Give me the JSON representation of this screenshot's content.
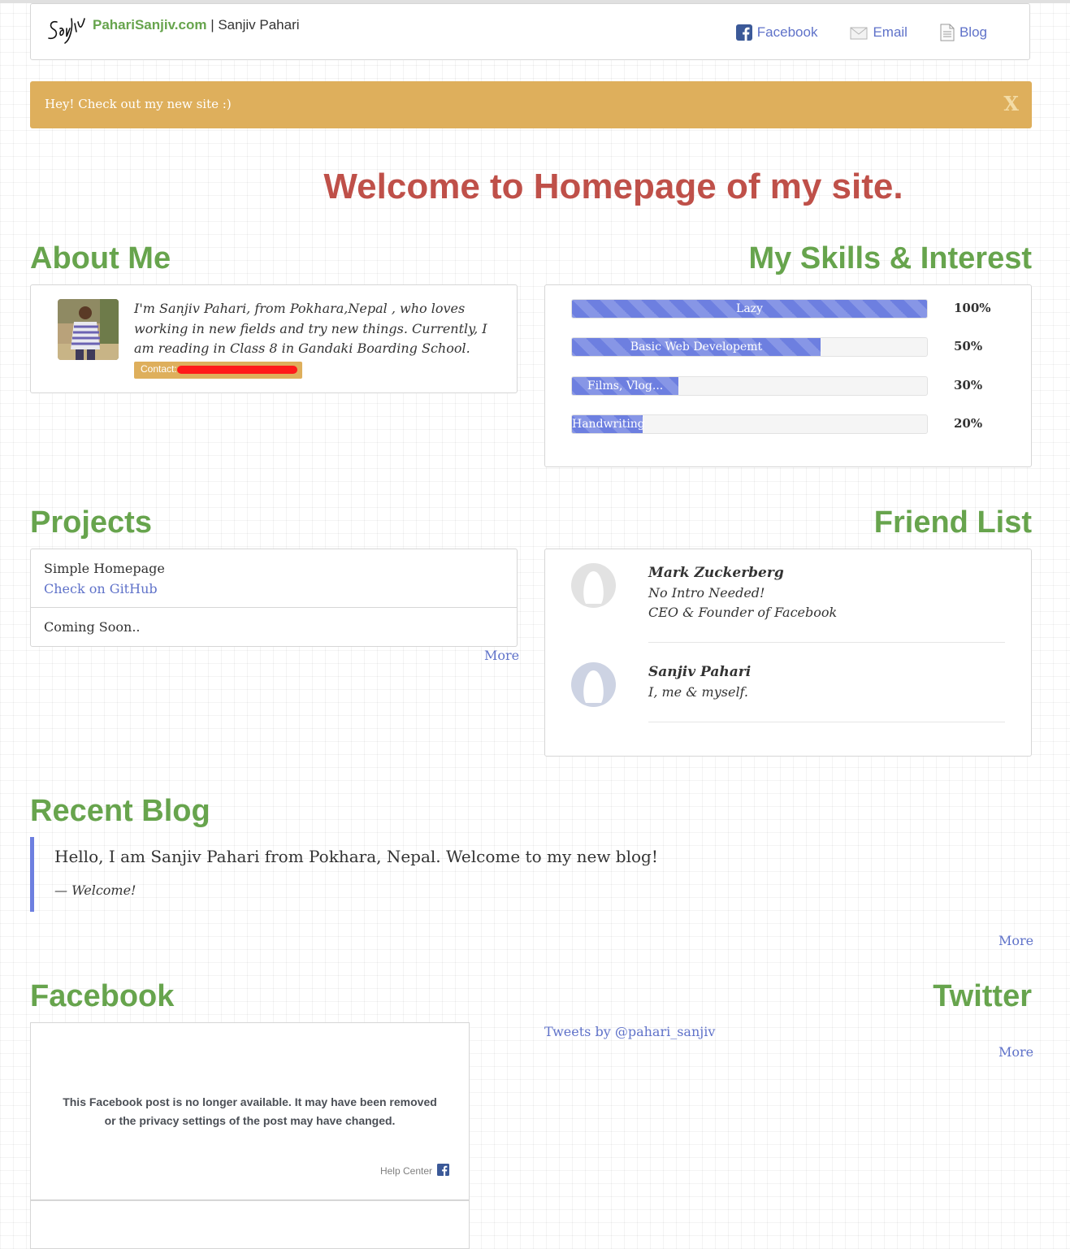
{
  "nav": {
    "site_name": "PahariSanjiv.com",
    "separator": " | ",
    "owner_name": "Sanjiv Pahari",
    "links": [
      {
        "label": "Facebook",
        "icon": "facebook-icon"
      },
      {
        "label": "Email",
        "icon": "email-icon"
      },
      {
        "label": "Blog",
        "icon": "document-icon"
      }
    ]
  },
  "alert": {
    "text": "Hey! Check out my new site :)",
    "close": "X"
  },
  "welcome": "Welcome to Homepage of my site.",
  "about": {
    "heading": "About Me",
    "text": "I'm Sanjiv Pahari, from Pokhara,Nepal , who loves working in new fields and try new things. Currently, I am reading in Class 8 in Gandaki Boarding School.",
    "contact_label": "Contact:"
  },
  "skills": {
    "heading": "My Skills & Interest",
    "items": [
      {
        "label": "Lazy",
        "percent": 100,
        "percent_text": "100%"
      },
      {
        "label": "Basic Web Developemt",
        "percent": 70,
        "percent_text": "50%"
      },
      {
        "label": "Films, Vlog...",
        "percent": 30,
        "percent_text": "30%"
      },
      {
        "label": "Handwriting",
        "percent": 20,
        "percent_text": "20%"
      }
    ]
  },
  "projects": {
    "heading": "Projects",
    "items": [
      {
        "title": "Simple Homepage",
        "link": "Check on GitHub"
      },
      {
        "title": "Coming Soon.."
      }
    ],
    "more": "More"
  },
  "friends": {
    "heading": "Friend List",
    "items": [
      {
        "name": "Mark Zuckerberg",
        "lines": [
          "No Intro Needed!",
          "CEO & Founder of Facebook"
        ]
      },
      {
        "name": "Sanjiv Pahari",
        "lines": [
          "I, me & myself."
        ]
      }
    ]
  },
  "blog": {
    "heading": "Recent Blog",
    "quote": "Hello, I am Sanjiv Pahari from Pokhara, Nepal. Welcome to my new blog!",
    "footer": "— Welcome!",
    "more": "More"
  },
  "facebook": {
    "heading": "Facebook",
    "message_line1": "This Facebook post is no longer available. It may have been removed",
    "message_line2": "or the privacy settings of the post may have changed.",
    "help": "Help Center"
  },
  "twitter": {
    "heading": "Twitter",
    "tweets_link": "Tweets by @pahari_sanjiv",
    "more": "More"
  },
  "colors": {
    "accent_green": "#67a44d",
    "accent_red": "#bf5049",
    "link_blue": "#5f72c9",
    "alert_gold": "#deaf5c",
    "progress_blue": "#6d7fe0"
  }
}
